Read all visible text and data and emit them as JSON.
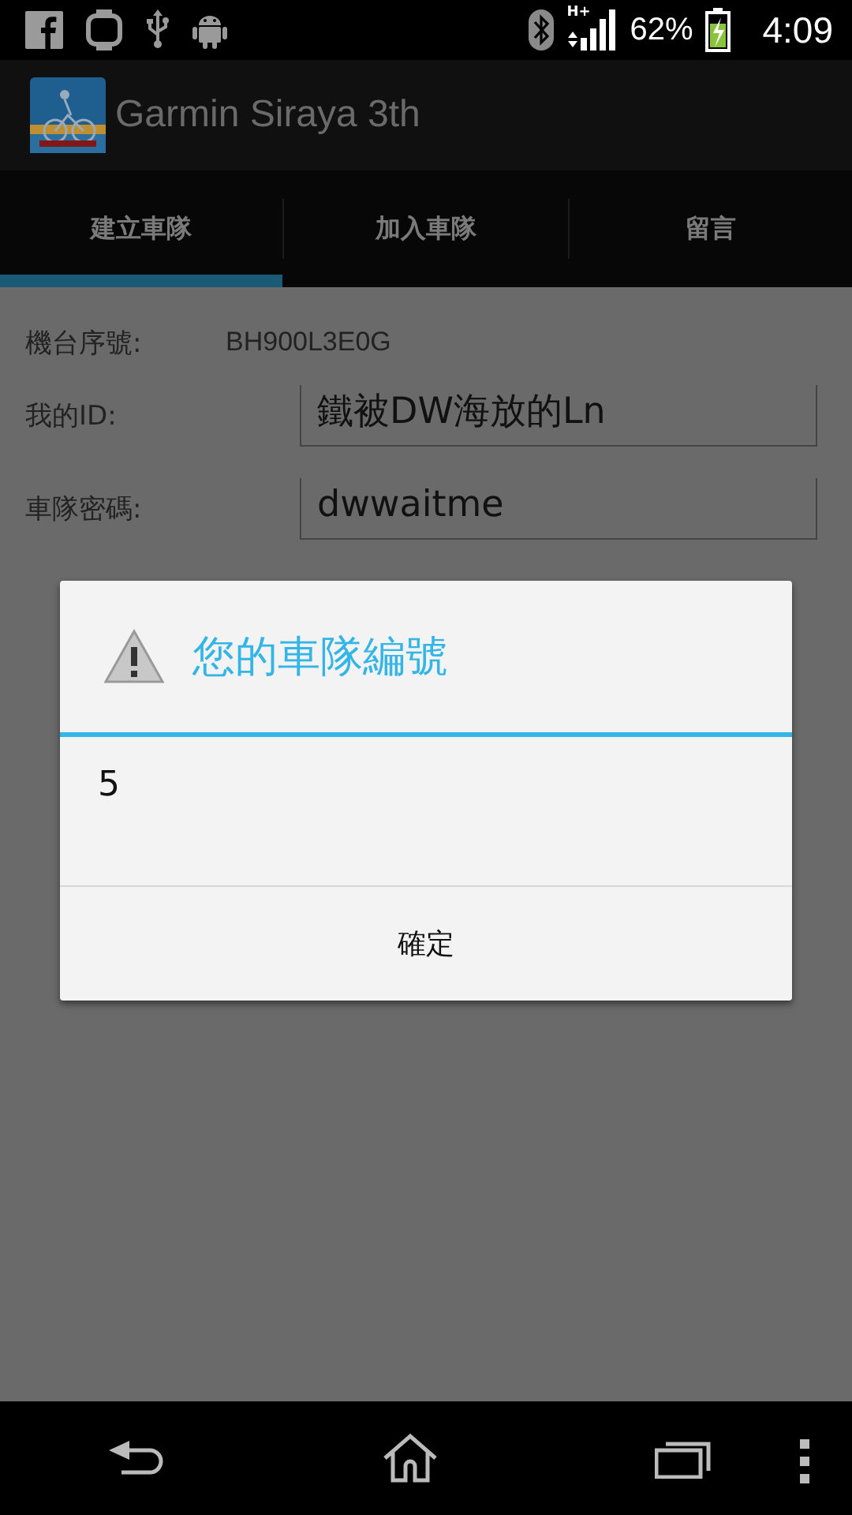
{
  "status_bar": {
    "network_type": "H+",
    "battery_percent": "62%",
    "time": "4:09"
  },
  "action_bar": {
    "title": "Garmin Siraya 3th"
  },
  "tabs": [
    {
      "label": "建立車隊",
      "selected": true
    },
    {
      "label": "加入車隊",
      "selected": false
    },
    {
      "label": "留言",
      "selected": false
    }
  ],
  "form": {
    "fields": [
      {
        "kind": "static",
        "label": "機台序號:",
        "value": "BH900L3E0G"
      },
      {
        "kind": "input",
        "label": "我的ID:",
        "value": "鐵被DW海放的Ln"
      },
      {
        "kind": "input",
        "label": "車隊密碼:",
        "value": "dwwaitme"
      }
    ]
  },
  "dialog": {
    "title": "您的車隊編號",
    "message": "5",
    "buttons": [
      "確定"
    ]
  }
}
